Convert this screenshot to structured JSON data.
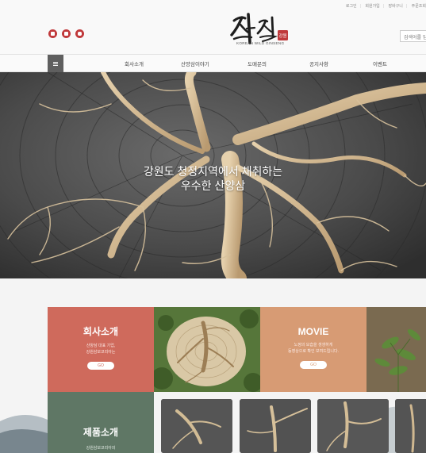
{
  "colors": {
    "company_tile": "#cf6a5c",
    "movie_tile": "#d79b74",
    "product_tile": "#5f7765",
    "social_icon": "#c0393b",
    "menu_button": "#5f5f5f"
  },
  "util_links": [
    "로그인",
    "회원가입",
    "장바구니",
    "주문조회"
  ],
  "social_icons": [
    "facebook-icon",
    "blog-icon",
    "instagram-icon"
  ],
  "logo": {
    "seal_text": "강원",
    "subtitle": "KOREAN WILD GINSENG"
  },
  "search": {
    "placeholder": "검색어를 입력하세요"
  },
  "nav": {
    "items": [
      "회사소개",
      "산양삼이야기",
      "도매문의",
      "공지사항",
      "이벤트"
    ]
  },
  "hero": {
    "line1": "강원도 청정지역에서 채취하는",
    "line2": "우수한 산양삼"
  },
  "tiles": {
    "company": {
      "title": "회사소개",
      "desc1": "산양삼 대표 기업,",
      "desc2": "강원삼보코리아는",
      "go": "GO"
    },
    "movie": {
      "title": "MOVIE",
      "desc1": "노정의 모습을 생생하게",
      "desc2": "동영상으로 확인 보여드립니다.",
      "go": "GO"
    },
    "product": {
      "title": "제품소개",
      "desc1": "강원삼보코리아의"
    }
  }
}
